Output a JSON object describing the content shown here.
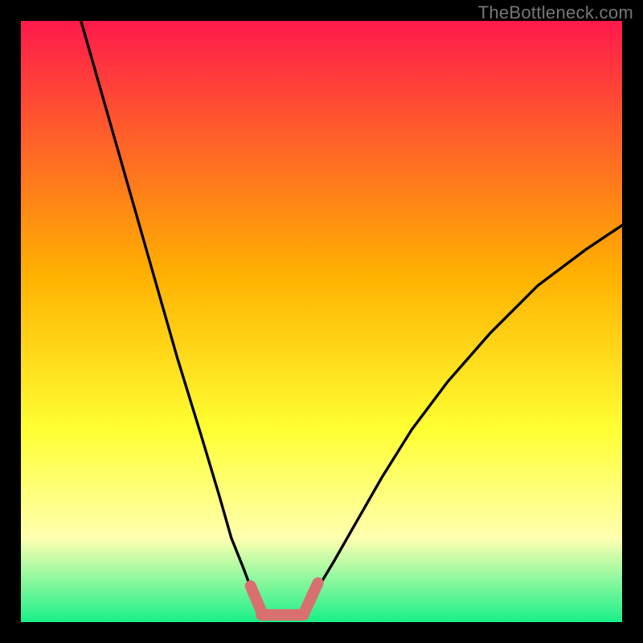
{
  "watermark": "TheBottleneck.com",
  "colors": {
    "frame": "#000000",
    "gradient_top": "#ff1a4c",
    "gradient_mid_upper": "#ffb000",
    "gradient_mid_lower": "#ffff33",
    "gradient_pale": "#ffffb0",
    "gradient_bottom": "#19f08a",
    "curve": "#000000",
    "marker": "#d97070"
  },
  "chart_data": {
    "type": "line",
    "title": "",
    "xlabel": "",
    "ylabel": "",
    "xlim": [
      0,
      100
    ],
    "ylim": [
      0,
      100
    ],
    "series": [
      {
        "name": "left-curve",
        "x": [
          10,
          14,
          18,
          22,
          26,
          30,
          33,
          35,
          37,
          38.5,
          40
        ],
        "values": [
          100,
          86,
          72,
          58,
          44,
          31,
          21,
          14,
          9,
          5,
          2
        ]
      },
      {
        "name": "right-curve",
        "x": [
          47,
          49,
          52,
          56,
          60,
          65,
          71,
          78,
          86,
          94,
          100
        ],
        "values": [
          2,
          5,
          10,
          17,
          24,
          32,
          40,
          48,
          56,
          62,
          66
        ]
      }
    ],
    "floor_segment": {
      "x": [
        40,
        47
      ],
      "y": [
        1.2,
        1.2
      ]
    },
    "markers": [
      {
        "name": "left-join",
        "x": [
          38.2,
          40.2
        ],
        "y": [
          6.0,
          1.3
        ]
      },
      {
        "name": "floor",
        "x": [
          40.0,
          47.0
        ],
        "y": [
          1.2,
          1.2
        ]
      },
      {
        "name": "right-join",
        "x": [
          47.0,
          49.4
        ],
        "y": [
          1.3,
          6.5
        ]
      }
    ]
  }
}
